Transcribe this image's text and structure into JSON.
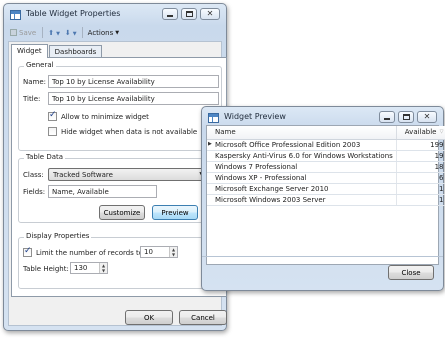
{
  "properties_window": {
    "title": "Table Widget Properties",
    "toolbar": {
      "save_label": "Save",
      "actions_label": "Actions"
    },
    "tabs": [
      {
        "label": "Widget",
        "active": true
      },
      {
        "label": "Dashboards",
        "active": false
      }
    ],
    "general": {
      "group_title": "General",
      "name_label": "Name:",
      "name_value": "Top 10 by License Availability",
      "title_label": "Title:",
      "title_value": "Top 10 by License Availability",
      "allow_minimize_label": "Allow to minimize widget",
      "allow_minimize_checked": true,
      "hide_widget_label": "Hide widget when data is not available",
      "hide_widget_checked": false
    },
    "table_data": {
      "group_title": "Table Data",
      "class_label": "Class:",
      "class_value": "Tracked Software",
      "fields_label": "Fields:",
      "fields_value": "Name, Available",
      "customize_label": "Customize",
      "preview_label": "Preview"
    },
    "display_properties": {
      "group_title": "Display Properties",
      "limit_label": "Limit the number of records to",
      "limit_checked": true,
      "limit_value": "10",
      "height_label": "Table Height:",
      "height_value": "130"
    },
    "ok_label": "OK",
    "cancel_label": "Cancel"
  },
  "preview_window": {
    "title": "Widget Preview",
    "columns": [
      "Name",
      "Available"
    ],
    "rows": [
      {
        "name": "Microsoft Office Professional Edition 2003",
        "available": "199"
      },
      {
        "name": "Kaspersky Anti-Virus 6.0 for Windows Workstations",
        "available": "19"
      },
      {
        "name": "Windows 7 Professional",
        "available": "18"
      },
      {
        "name": "Windows XP - Professional",
        "available": "6"
      },
      {
        "name": "Microsoft Exchange Server 2010",
        "available": "1"
      },
      {
        "name": "Microsoft Windows 2003 Server",
        "available": "1"
      }
    ],
    "close_label": "Close"
  },
  "icons": {
    "app": "table-icon",
    "save": "floppy-icon",
    "move_up": "arrow-up-icon",
    "move_down": "arrow-down-icon",
    "row_selector": "triangle-right-icon",
    "sort": "sort-icon"
  }
}
